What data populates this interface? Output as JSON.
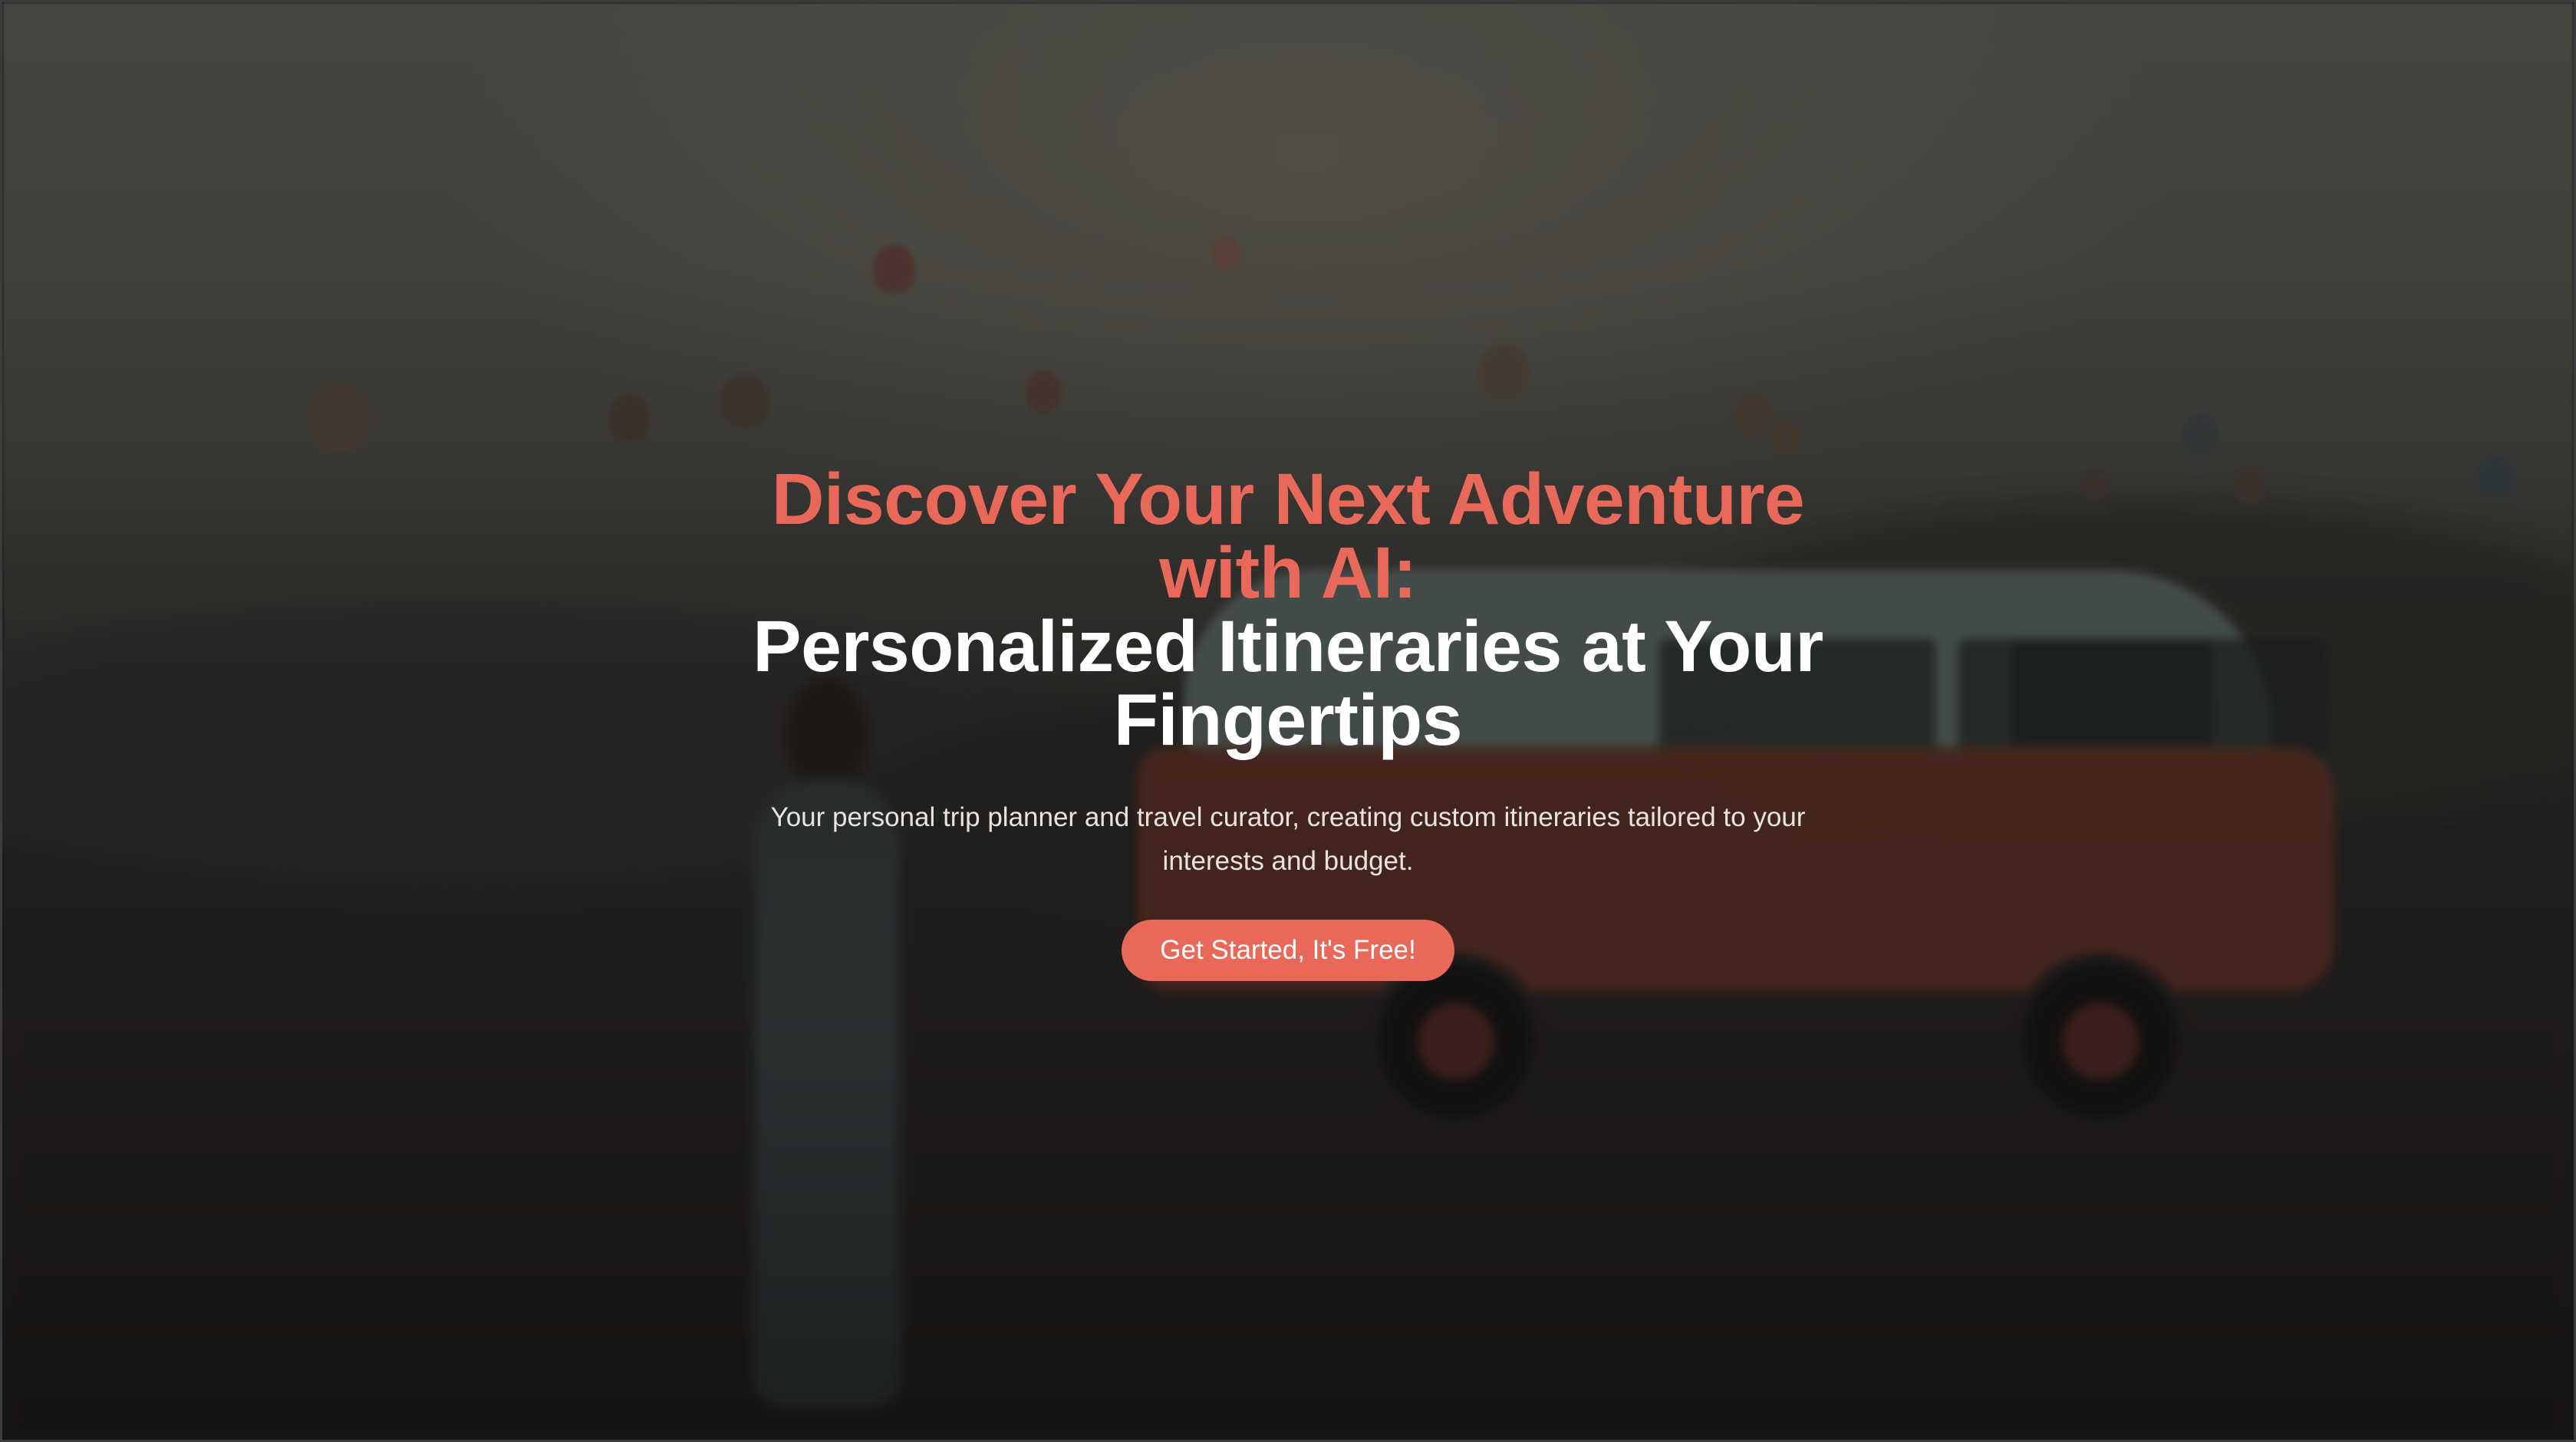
{
  "hero": {
    "title_accent_line1": "Discover Your Next Adventure",
    "title_accent_line2": "with AI:",
    "title_main_line1": "Personalized Itineraries at Your",
    "title_main_line2": "Fingertips",
    "subtitle": "Your personal trip planner and travel curator, creating custom itineraries tailored to your interests and budget.",
    "cta_label": "Get Started, It's Free!"
  },
  "colors": {
    "accent": "#e8695a",
    "title_white": "#ffffff",
    "subtitle": "#e7e3df"
  },
  "background_image": {
    "icon": "hot-air-balloons-van-photo"
  }
}
